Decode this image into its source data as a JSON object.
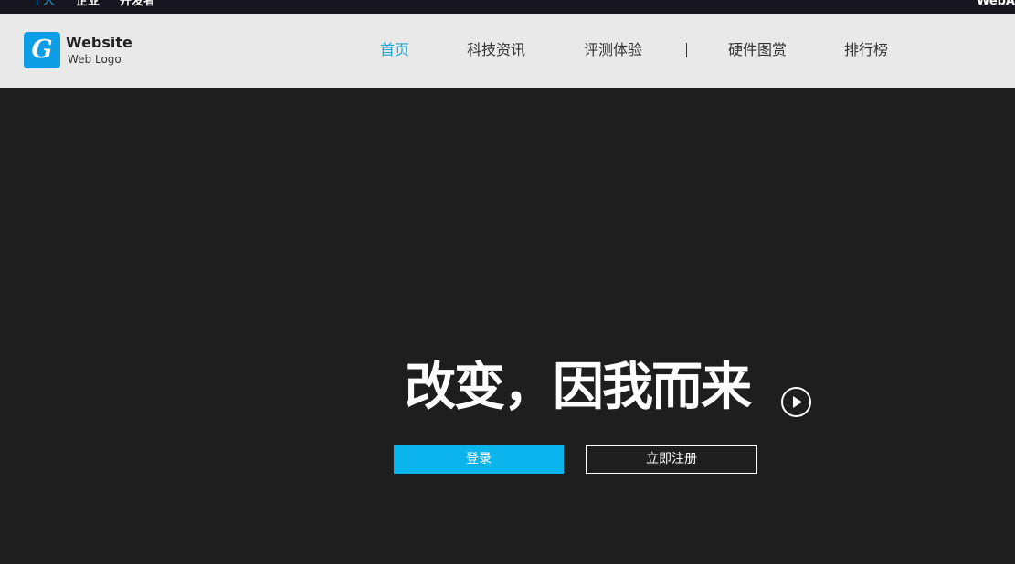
{
  "topbar": {
    "items": [
      {
        "label": "个人",
        "active": true
      },
      {
        "label": "企业",
        "active": false
      },
      {
        "label": "开发者",
        "active": false
      }
    ],
    "right_text": "WebA"
  },
  "header": {
    "logo": {
      "mark": "G",
      "title": "Website",
      "subtitle": "Web Logo"
    },
    "nav": [
      {
        "label": "首页",
        "active": true
      },
      {
        "label": "科技资讯",
        "active": false
      },
      {
        "label": "评测体验",
        "active": false
      },
      {
        "label": "硬件图赏",
        "active": false
      },
      {
        "label": "排行榜",
        "active": false
      }
    ]
  },
  "hero": {
    "slogan": "改变，因我而来",
    "login_label": "登录",
    "register_label": "立即注册"
  },
  "colors": {
    "accent": "#0bb4ec",
    "nav_active": "#1aa5d8",
    "hero_bg": "#1e1e1e",
    "header_bg": "#e9e9e9",
    "topbar_bg": "#161520"
  }
}
